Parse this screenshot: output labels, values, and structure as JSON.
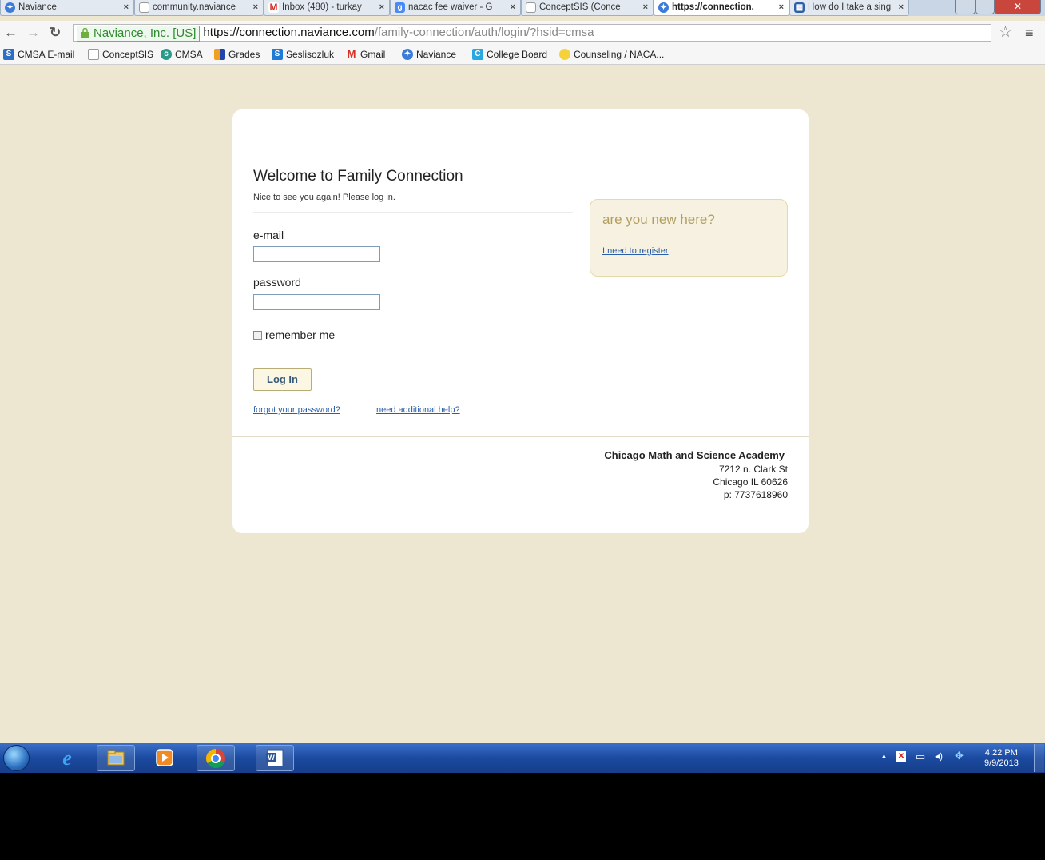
{
  "tabs": [
    {
      "title": "Naviance",
      "icon": "naviance-icon"
    },
    {
      "title": "community.naviance",
      "icon": "page-icon"
    },
    {
      "title": "Inbox (480) - turkay",
      "icon": "gmail-icon"
    },
    {
      "title": "nacac fee waiver - G",
      "icon": "google-icon"
    },
    {
      "title": "ConceptSIS (Conce",
      "icon": "page-icon"
    },
    {
      "title": "https://connection.",
      "icon": "naviance-icon",
      "active": true
    },
    {
      "title": "How do I take a sing",
      "icon": "calendar-grid-icon"
    }
  ],
  "omnibox": {
    "ev_label": "Naviance, Inc. [US]",
    "url_main": "https://connection.naviance.com",
    "url_rest": "/family-connection/auth/login/?hsid=cmsa"
  },
  "bookmarks": [
    {
      "label": "CMSA E-mail",
      "icon": "mail-icon"
    },
    {
      "label": "ConceptSIS",
      "icon": "page-icon"
    },
    {
      "label": "CMSA",
      "icon": "cmsa-icon"
    },
    {
      "label": "Grades",
      "icon": "grades-icon"
    },
    {
      "label": "Seslisozluk",
      "icon": "s-icon"
    },
    {
      "label": "Gmail",
      "icon": "gmail-icon"
    },
    {
      "label": "Naviance",
      "icon": "naviance-icon"
    },
    {
      "label": "College Board",
      "icon": "collegeboard-icon"
    },
    {
      "label": "Counseling / NACA...",
      "icon": "folder-icon"
    }
  ],
  "login": {
    "title": "Welcome to Family Connection",
    "subtitle": "Nice to see you again! Please log in.",
    "email_label": "e-mail",
    "email_value": "",
    "password_label": "password",
    "password_value": "",
    "remember_label": "remember me",
    "remember_checked": false,
    "button_label": "Log In",
    "forgot_link": "forgot your password?",
    "help_link": "need additional help?"
  },
  "new_here": {
    "heading": "are you new here?",
    "register_link": "I need to register"
  },
  "school": {
    "name": "Chicago Math and Science Academy",
    "street": "7212 n. Clark St",
    "city": "Chicago IL 60626",
    "phone": "p: 7737618960"
  },
  "taskbar": {
    "time": "4:22 PM",
    "date": "9/9/2013",
    "pinned": [
      "ie-icon",
      "explorer-icon",
      "media-player-icon",
      "chrome-icon",
      "word-icon"
    ]
  },
  "colors": {
    "page_bg": "#ede7d1",
    "link": "#2a5ea8",
    "new_here_heading": "#b29f60",
    "taskbar": "#1b4aa0"
  }
}
